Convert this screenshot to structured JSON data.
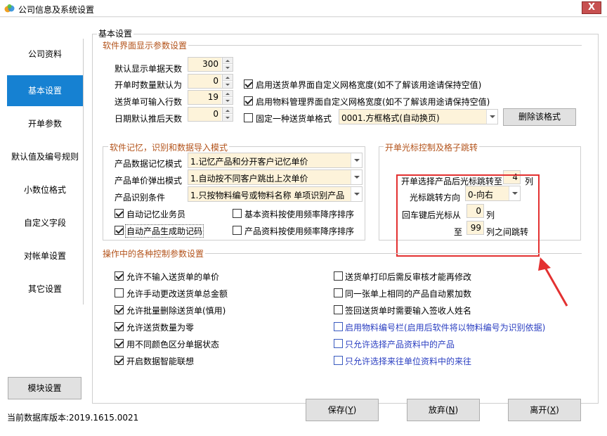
{
  "window": {
    "title": "公司信息及系统设置",
    "close_glyph": "X"
  },
  "sidebar": {
    "items": [
      {
        "label": "公司资料",
        "active": false
      },
      {
        "label": "基本设置",
        "active": true
      },
      {
        "label": "开单参数",
        "active": false
      },
      {
        "label": "默认值及编号规则",
        "active": false
      },
      {
        "label": "小数位格式",
        "active": false
      },
      {
        "label": "自定义字段",
        "active": false
      },
      {
        "label": "对帐单设置",
        "active": false
      },
      {
        "label": "其它设置",
        "active": false
      }
    ],
    "module_button": "模块设置"
  },
  "status": {
    "db_version": "当前数据库版本:2019.1615.0021"
  },
  "panel": {
    "title": "基本设置"
  },
  "display_section": {
    "title": "软件界面显示参数设置",
    "fields": [
      {
        "label": "默认显示单据天数",
        "value": "300"
      },
      {
        "label": "开单时数量默认为",
        "value": "0"
      },
      {
        "label": "送货单可输入行数",
        "value": "19"
      },
      {
        "label": "日期默认推后天数",
        "value": "0"
      }
    ],
    "checks": [
      {
        "label": "启用送货单界面自定义网格宽度(如不了解该用途请保持空值)",
        "checked": true
      },
      {
        "label": "启用物料管理界面自定义网格宽度(如不了解该用途请保持空值)",
        "checked": true
      },
      {
        "label": "固定一种送货单格式",
        "checked": false
      }
    ],
    "format_select": "0001.方框格式(自动换页)",
    "delete_format_button": "删除该格式"
  },
  "memory_section": {
    "title": "软件记忆，识别和数据导入模式",
    "rows": [
      {
        "label": "产品数据记忆模式",
        "value": "1.记忆产品和分开客户记忆单价"
      },
      {
        "label": "产品单价弹出模式",
        "value": "1.自动按不同客户跳出上次单价"
      },
      {
        "label": "产品识别条件",
        "value": "1.只按物料编号或物料名称 单项识别产品"
      }
    ],
    "checks": [
      {
        "label": "自动记忆业务员",
        "checked": true
      },
      {
        "label": "基本资料按使用频率降序排序",
        "checked": false
      },
      {
        "label": "自动产品生成助记码",
        "checked": true
      },
      {
        "label": "产品资料按使用频率降序排序",
        "checked": false
      }
    ]
  },
  "cursor_section": {
    "title": "开单光标控制及格子跳转",
    "jump_label": "开单选择产品后光标跳转至",
    "jump_value": "4",
    "jump_unit": "列",
    "direction_label": "光标跳转方向",
    "direction_value": "0-向右",
    "enter_label": "回车键后光标从",
    "enter_value": "0",
    "enter_unit": "列",
    "to_label": "至",
    "to_value": "99",
    "to_unit": "列之间跳转"
  },
  "control_section": {
    "title": "操作中的各种控制参数设置",
    "left": [
      {
        "label": "允许不输入送货单的单价",
        "checked": true
      },
      {
        "label": "允许手动更改送货单总金额",
        "checked": false
      },
      {
        "label": "允许批量删除送货单(慎用)",
        "checked": true
      },
      {
        "label": "允许送货数量为零",
        "checked": true
      },
      {
        "label": "用不同颜色区分单据状态",
        "checked": true
      },
      {
        "label": "开启数据智能联想",
        "checked": true
      }
    ],
    "right": [
      {
        "label": "送货单打印后需反审核才能再修改",
        "checked": false,
        "blue": false
      },
      {
        "label": "同一张单上相同的产品自动累加数",
        "checked": false,
        "blue": false
      },
      {
        "label": "签回送货单时需要输入签收人姓名",
        "checked": false,
        "blue": false
      },
      {
        "label": "启用物料编号栏(启用后软件将以物料编号为识别依据)",
        "checked": false,
        "blue": true
      },
      {
        "label": "只允许选择产品资料中的产品",
        "checked": false,
        "blue": true
      },
      {
        "label": "只允许选择来往单位资料中的来往",
        "checked": false,
        "blue": true
      }
    ]
  },
  "footer": {
    "save": {
      "text": "保存(",
      "key": "Y",
      "close": ")"
    },
    "discard": {
      "text": "放弃(",
      "key": "N",
      "close": ")"
    },
    "exit": {
      "text": "离开(",
      "key": "X",
      "close": ")"
    }
  },
  "colors": {
    "accent": "#1681d2",
    "section_title": "#b3531b",
    "field_bg": "#fdf3da",
    "highlight": "#e33131",
    "link_blue": "#2a3ec1"
  }
}
